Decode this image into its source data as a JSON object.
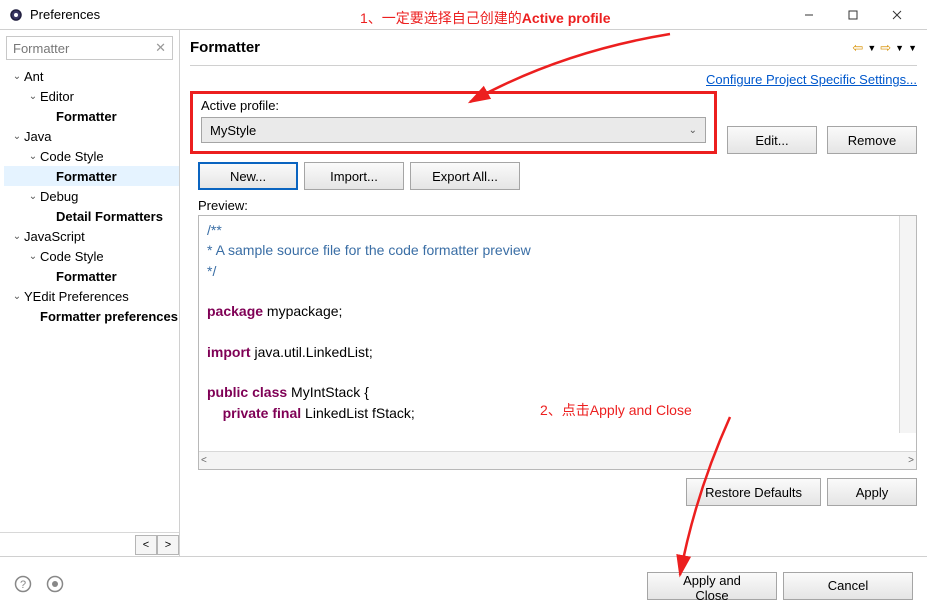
{
  "titlebar": {
    "title": "Preferences"
  },
  "filter": {
    "text": "Formatter"
  },
  "tree": [
    {
      "level": 0,
      "expanded": true,
      "label": "Ant",
      "bold": false
    },
    {
      "level": 1,
      "expanded": true,
      "label": "Editor",
      "bold": false
    },
    {
      "level": 2,
      "expanded": null,
      "label": "Formatter",
      "bold": true
    },
    {
      "level": 0,
      "expanded": true,
      "label": "Java",
      "bold": false
    },
    {
      "level": 1,
      "expanded": true,
      "label": "Code Style",
      "bold": false
    },
    {
      "level": 2,
      "expanded": null,
      "label": "Formatter",
      "bold": true,
      "selected": true
    },
    {
      "level": 1,
      "expanded": true,
      "label": "Debug",
      "bold": false
    },
    {
      "level": 2,
      "expanded": null,
      "label": "Detail Formatters",
      "bold": true
    },
    {
      "level": 0,
      "expanded": true,
      "label": "JavaScript",
      "bold": false
    },
    {
      "level": 1,
      "expanded": true,
      "label": "Code Style",
      "bold": false
    },
    {
      "level": 2,
      "expanded": null,
      "label": "Formatter",
      "bold": true
    },
    {
      "level": 0,
      "expanded": true,
      "label": "YEdit Preferences",
      "bold": false
    },
    {
      "level": 1,
      "expanded": null,
      "label": "Formatter preferences",
      "bold": true
    }
  ],
  "header": {
    "title": "Formatter"
  },
  "link": "Configure Project Specific Settings...",
  "active": {
    "label": "Active profile:",
    "value": "MyStyle",
    "edit": "Edit...",
    "remove": "Remove"
  },
  "buttons": {
    "new": "New...",
    "import": "Import...",
    "export": "Export All..."
  },
  "preview": {
    "label": "Preview:",
    "comment1": "/**",
    "comment2": "* A sample source file for the code formatter preview",
    "comment3": "*/",
    "line_package_kw": "package",
    "line_package_rest": " mypackage;",
    "line_import_kw": "import",
    "line_import_rest": " java.util.LinkedList;",
    "line_class_kw1": "public",
    "line_class_kw2": "class",
    "line_class_rest": " MyIntStack {",
    "line_field_kw1": "private",
    "line_field_kw2": "final",
    "line_field_rest": " LinkedList fStack;"
  },
  "restore": {
    "defaults": "Restore Defaults",
    "apply": "Apply"
  },
  "footer": {
    "apply_close": "Apply and Close",
    "cancel": "Cancel"
  },
  "annotations": {
    "a1_prefix": "1、一定要选择自己创建的",
    "a1_em": "Active profile",
    "a2_prefix": "2、点击",
    "a2_em": "Apply and Close"
  }
}
